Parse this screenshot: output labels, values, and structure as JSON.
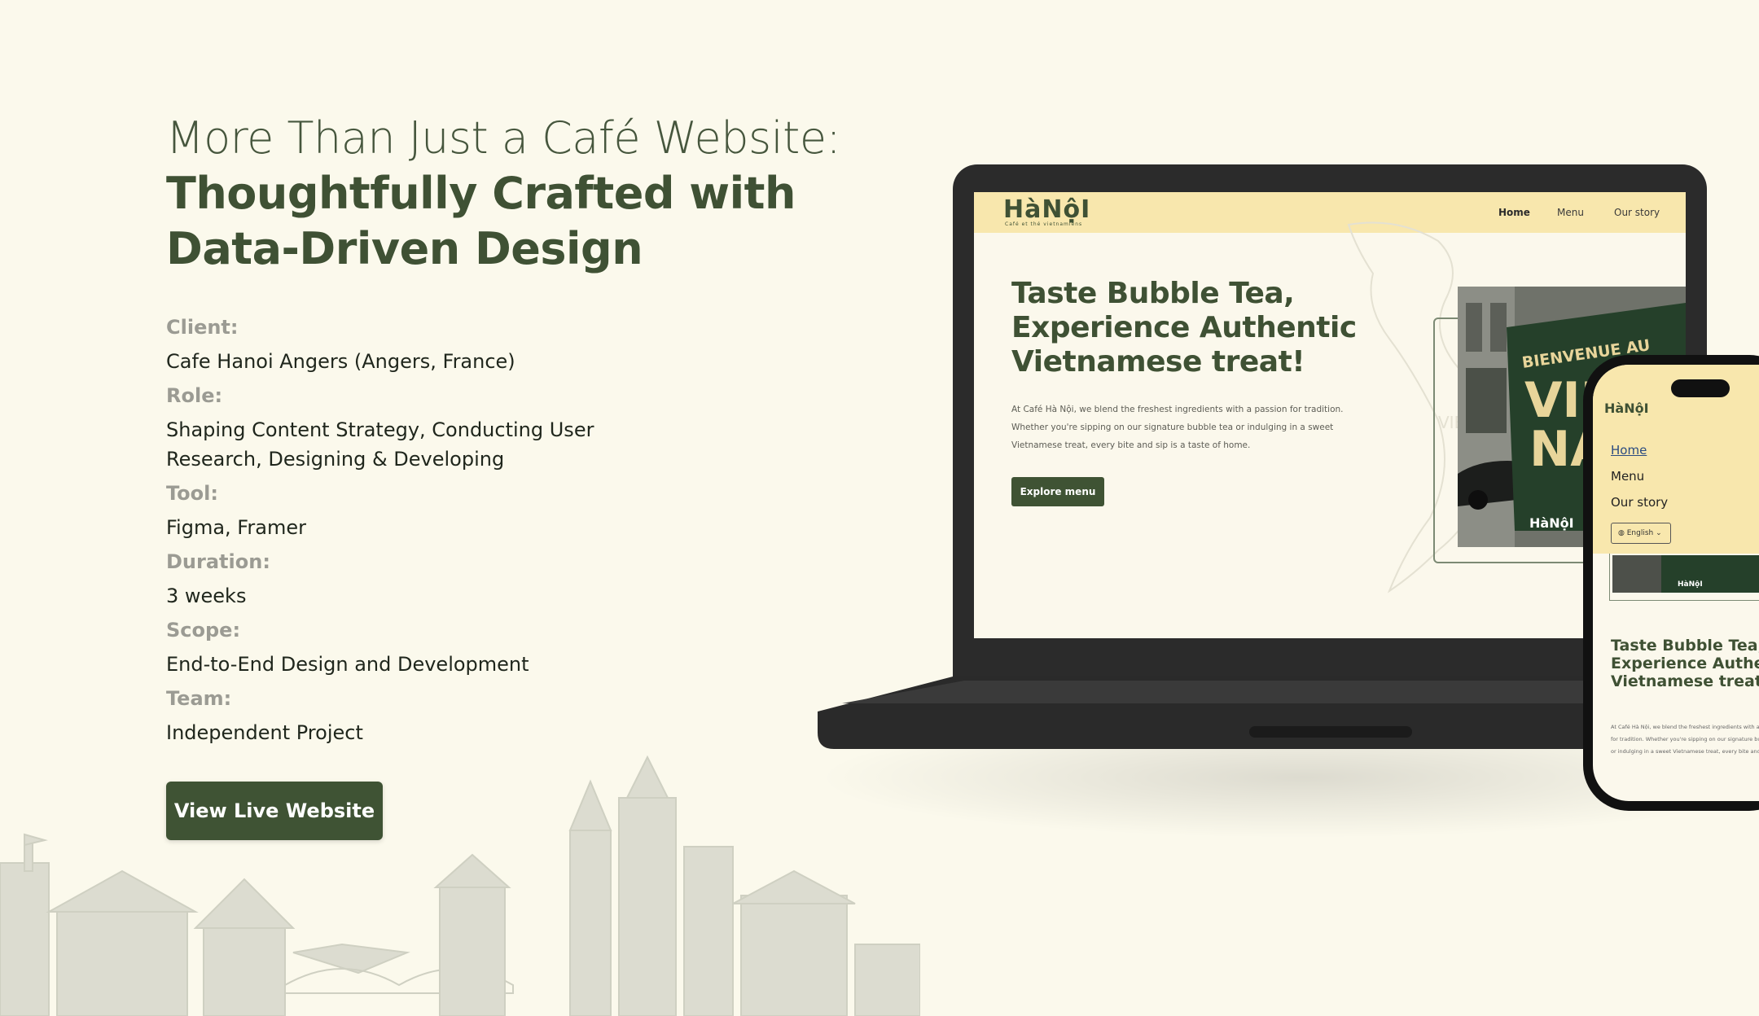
{
  "headline": {
    "line1": "More Than Just a Café Website:",
    "line2": "Thoughtfully Crafted with",
    "line3": "Data-Driven Design"
  },
  "info": [
    {
      "label": "Client:",
      "value": "Cafe Hanoi Angers (Angers, France)"
    },
    {
      "label": "Role:",
      "value": "Shaping Content Strategy, Conducting User Research, Designing & Developing"
    },
    {
      "label": "Tool:",
      "value": "Figma, Framer"
    },
    {
      "label": "Duration:",
      "value": "3 weeks"
    },
    {
      "label": "Scope:",
      "value": "End-to-End Design and Development"
    },
    {
      "label": "Team:",
      "value": "Independent Project"
    }
  ],
  "cta_label": "View Live Website",
  "mockup": {
    "logo": "HàNộI",
    "logo_sub": "Café et thé vietnamiens",
    "nav": {
      "home": "Home",
      "menu": "Menu",
      "story": "Our story"
    },
    "hero_title": "Taste Bubble Tea, Experience Authentic Vietnamese treat!",
    "hero_text": "At Café Hà Nội, we blend the freshest ingredients with a passion for tradition. Whether you're sipping on our signature bubble tea or indulging in a sweet Vietnamese treat, every bite and sip is a taste of home.",
    "hero_button": "Explore menu",
    "map_label": "VIETNAM",
    "sign_line1": "BIENVENUE AU",
    "sign_line2": "VIE",
    "sign_line3": "NA",
    "sign_logo": "HàNộI"
  },
  "phone": {
    "logo": "HàNộI",
    "nav": {
      "home": "Home",
      "menu": "Menu",
      "story": "Our story"
    },
    "language": "English",
    "photo_logo": "HàNộI",
    "title": "Taste Bubble Tea, Experience Authentic Vietnamese treat!",
    "text_lines": [
      "At Café Hà Nội, we blend the freshest ingredients with a p",
      "for tradition. Whether you're sipping on our signature bubb",
      "or indulging in a sweet Vietnamese treat, every bite and si"
    ]
  },
  "colors": {
    "background": "#fbf9ec",
    "brand_green": "#3f5334",
    "nav_yellow": "#f8e7ad",
    "label_gray": "#9b9b93"
  }
}
